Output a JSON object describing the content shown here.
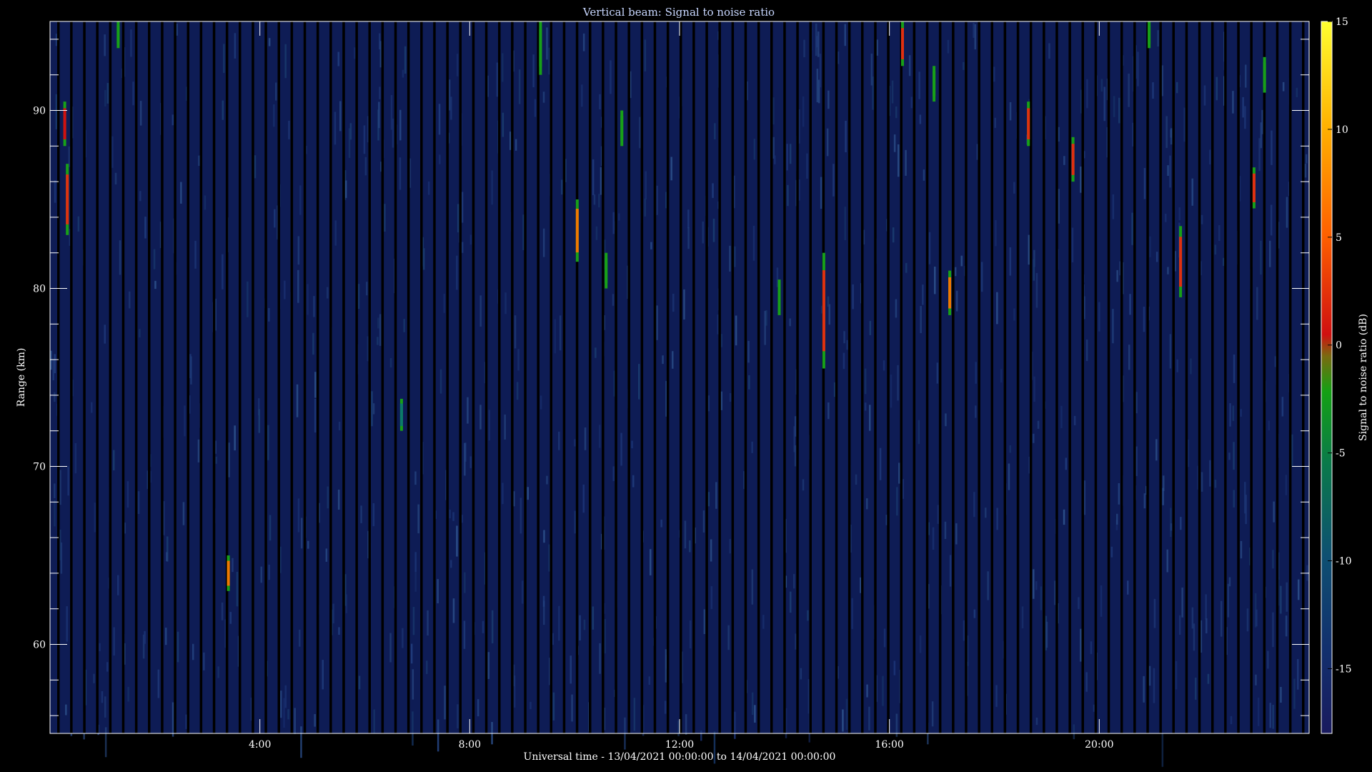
{
  "chart_data": {
    "type": "heatmap",
    "title": "Vertical beam: Signal to noise ratio",
    "xlabel": "Universal time - 13/04/2021 00:00:00 to 14/04/2021 00:00:00",
    "ylabel": "Range (km)",
    "colorbar_label": "Signal to noise ratio (dB)",
    "x_unit": "hours UT",
    "xlim": [
      0,
      24
    ],
    "ylim": [
      55,
      95
    ],
    "x_ticks": [
      4,
      8,
      12,
      16,
      20
    ],
    "x_tick_labels": [
      "4:00",
      "8:00",
      "12:00",
      "16:00",
      "20:00"
    ],
    "y_ticks": [
      60,
      70,
      80,
      90
    ],
    "y_tick_labels": [
      "60",
      "70",
      "80",
      "90"
    ],
    "colorbar_range": [
      -18,
      15
    ],
    "colorbar_ticks": [
      15,
      10,
      5,
      0,
      -5,
      -10,
      -15
    ],
    "colorbar_tick_labels": [
      "15",
      "10",
      "5",
      "0",
      "-5",
      "-10",
      "-15"
    ],
    "colormap": [
      "#191a5e",
      "#0f4a78",
      "#0a7a4a",
      "#14a014",
      "#8a6010",
      "#d01010",
      "#ff8000",
      "#ffd000",
      "#ffff40"
    ],
    "background_color": "#0e1c55",
    "events": [
      {
        "t": 0.28,
        "r1": 88.0,
        "r2": 90.5,
        "snr": -1
      },
      {
        "t": 0.33,
        "r1": 83.0,
        "r2": 87.0,
        "snr": 0
      },
      {
        "t": 1.3,
        "r1": 93.5,
        "r2": 95.0,
        "snr": -8
      },
      {
        "t": 3.4,
        "r1": 63.0,
        "r2": 65.0,
        "snr": 3
      },
      {
        "t": 6.7,
        "r1": 72.0,
        "r2": 73.8,
        "snr": -9
      },
      {
        "t": 9.35,
        "r1": 92.0,
        "r2": 95.0,
        "snr": -6
      },
      {
        "t": 10.05,
        "r1": 81.5,
        "r2": 85.0,
        "snr": 4
      },
      {
        "t": 10.6,
        "r1": 80.0,
        "r2": 82.0,
        "snr": -5
      },
      {
        "t": 10.9,
        "r1": 88.0,
        "r2": 90.0,
        "snr": -5
      },
      {
        "t": 13.9,
        "r1": 78.5,
        "r2": 80.5,
        "snr": -5
      },
      {
        "t": 14.75,
        "r1": 75.5,
        "r2": 82.0,
        "snr": 0
      },
      {
        "t": 16.25,
        "r1": 92.5,
        "r2": 95.0,
        "snr": 0
      },
      {
        "t": 16.85,
        "r1": 90.5,
        "r2": 92.5,
        "snr": -5
      },
      {
        "t": 17.15,
        "r1": 78.5,
        "r2": 81.0,
        "snr": 3
      },
      {
        "t": 18.65,
        "r1": 88.0,
        "r2": 90.5,
        "snr": 0
      },
      {
        "t": 19.5,
        "r1": 86.0,
        "r2": 88.5,
        "snr": 0
      },
      {
        "t": 20.95,
        "r1": 93.5,
        "r2": 95.0,
        "snr": -6
      },
      {
        "t": 21.55,
        "r1": 79.5,
        "r2": 83.5,
        "snr": 0
      },
      {
        "t": 22.95,
        "r1": 84.5,
        "r2": 86.8,
        "snr": 1
      },
      {
        "t": 23.15,
        "r1": 91.0,
        "r2": 93.0,
        "snr": -6
      }
    ]
  }
}
